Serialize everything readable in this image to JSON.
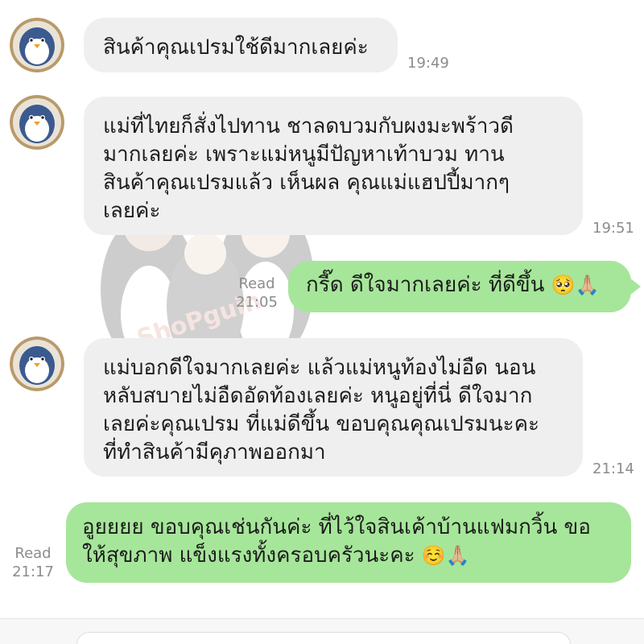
{
  "messages": [
    {
      "direction": "incoming",
      "avatar": "penguin-avatar-icon",
      "lines": [
        "สินค้าคุณเปรมใช้ดีมากเลยค่ะ"
      ],
      "time": "19:49"
    },
    {
      "direction": "incoming",
      "avatar": "penguin-avatar-icon",
      "lines": [
        "แม่ที่ไทยก็สั่งไปทาน ชาลดบวมกับผงมะพร้าวดี",
        "มากเลยค่ะ เพราะแม่หนูมีปัญหาเท้าบวม ทาน",
        "สินค้าคุณเปรมแล้ว เห็นผล คุณแม่แฮปปี้มากๆ",
        "เลยค่ะ"
      ],
      "time": "19:51"
    },
    {
      "direction": "outgoing",
      "text": "กรี๊ด ดีใจมากเลยค่ะ ที่ดีขึ้น",
      "emoji": "🥺🙏🏼",
      "read": "Read",
      "time": "21:05"
    },
    {
      "direction": "incoming",
      "avatar": "penguin-avatar-icon",
      "lines": [
        "แม่บอกดีใจมากเลยค่ะ แล้วแม่หนูท้องไม่อืด นอน",
        "หลับสบายไม่อืดอัดท้องเลยค่ะ หนูอยู่ที่นี่ ดีใจมาก",
        "เลยค่ะคุณเปรม ที่แม่ดีขึ้น ขอบคุณคุณเปรมนะคะ",
        "ที่ทำสินค้ามีคุภาพออกมา"
      ],
      "time": "21:14"
    },
    {
      "direction": "outgoing",
      "lines": [
        "อูยยยย ขอบคุณเช่นกันค่ะ ที่ไว้ใจสินเค้าบ้านแฟมกวิ้น ขอ",
        "ให้สุขภาพ แข็งแรงทั้งครอบครัวนะคะ"
      ],
      "emoji": "☺️🙏🏼",
      "read": "Read",
      "time": "21:17"
    }
  ],
  "watermark": {
    "text": "ShoPguin",
    "icon": "family-penguin-costume-watermark"
  },
  "colors": {
    "incoming_bubble": "#efefef",
    "outgoing_bubble": "#a6e69a",
    "timestamp": "#8c8c8c",
    "background": "#ffffff"
  },
  "input": {
    "placeholder": ""
  }
}
